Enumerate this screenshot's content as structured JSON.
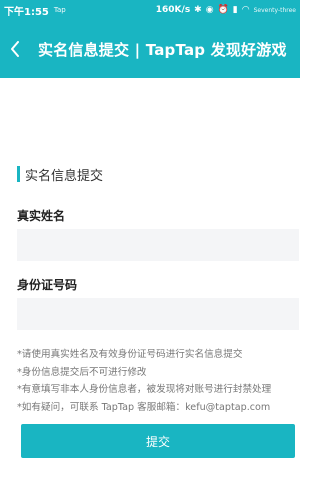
{
  "status_bar": {
    "time": "下午1:55",
    "app_tag": "Tap",
    "speed": "160K/s",
    "carrier": "Seventy-three"
  },
  "header": {
    "title": "实名信息提交 | TapTap 发现好游戏"
  },
  "form": {
    "section_title": "实名信息提交",
    "name_label": "真实姓名",
    "name_value": "",
    "id_label": "身份证号码",
    "id_value": ""
  },
  "notes": [
    "*请使用真实姓名及有效身份证号码进行实名信息提交",
    "*身份信息提交后不可进行修改",
    "*有意填写非本人身份信息者，被发现将对账号进行封禁处理",
    "*如有疑问，可联系 TapTap 客服邮箱：kefu@taptap.com"
  ],
  "submit_label": "提交",
  "colors": {
    "accent": "#19b5c2",
    "field_bg": "#f4f5f7"
  }
}
